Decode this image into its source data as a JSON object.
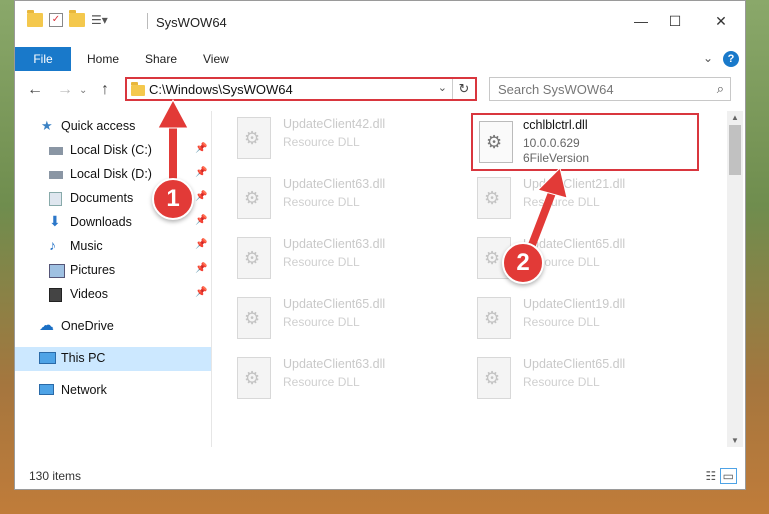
{
  "window": {
    "title": "SysWOW64",
    "controls": {
      "minimize": "—",
      "maximize": "☐",
      "close": "✕"
    }
  },
  "ribbon": {
    "tabs": [
      "File",
      "Home",
      "Share",
      "View"
    ],
    "help": "?",
    "collapse": "⌄"
  },
  "navigation": {
    "back": "←",
    "forward": "→",
    "up": "↑",
    "address": "C:\\Windows\\SysWOW64",
    "search_placeholder": "Search SysWOW64"
  },
  "sidebar": {
    "items": [
      {
        "label": "Quick access",
        "icon": "star-icon"
      },
      {
        "label": "Local Disk (C:)",
        "icon": "drive-icon",
        "pinned": true
      },
      {
        "label": "Local Disk (D:)",
        "icon": "drive-icon",
        "pinned": true
      },
      {
        "label": "Documents",
        "icon": "documents-icon",
        "pinned": true
      },
      {
        "label": "Downloads",
        "icon": "downloads-icon",
        "pinned": true
      },
      {
        "label": "Music",
        "icon": "music-icon",
        "pinned": true
      },
      {
        "label": "Pictures",
        "icon": "pictures-icon",
        "pinned": true
      },
      {
        "label": "Videos",
        "icon": "videos-icon",
        "pinned": true
      },
      {
        "label": "OneDrive",
        "icon": "cloud-icon"
      },
      {
        "label": "This PC",
        "icon": "computer-icon",
        "selected": true
      },
      {
        "label": "Network",
        "icon": "network-icon"
      }
    ]
  },
  "files": [
    {
      "name": "UpdateClient42.dll",
      "desc": "Resource DLL"
    },
    {
      "name": "cchlblctrl.dll",
      "desc": "10.0.0.629",
      "desc2": "6FileVersion",
      "highlighted": true
    },
    {
      "name": "UpdateClient63.dll",
      "desc": "Resource DLL"
    },
    {
      "name": "UpdateClient21.dll",
      "desc": "Resource DLL"
    },
    {
      "name": "UpdateClient63.dll",
      "desc": "Resource DLL"
    },
    {
      "name": "UpdateClient65.dll",
      "desc": "Resource DLL"
    },
    {
      "name": "UpdateClient65.dll",
      "desc": "Resource DLL"
    },
    {
      "name": "UpdateClient19.dll",
      "desc": "Resource DLL"
    },
    {
      "name": "UpdateClient63.dll",
      "desc": "Resource DLL"
    },
    {
      "name": "UpdateClient65.dll",
      "desc": "Resource DLL"
    }
  ],
  "status": {
    "item_count": "130 items"
  },
  "annotations": [
    {
      "number": "1"
    },
    {
      "number": "2"
    }
  ],
  "colors": {
    "accent": "#1979ca",
    "highlight": "#d9363e",
    "selected": "#cce8ff"
  }
}
